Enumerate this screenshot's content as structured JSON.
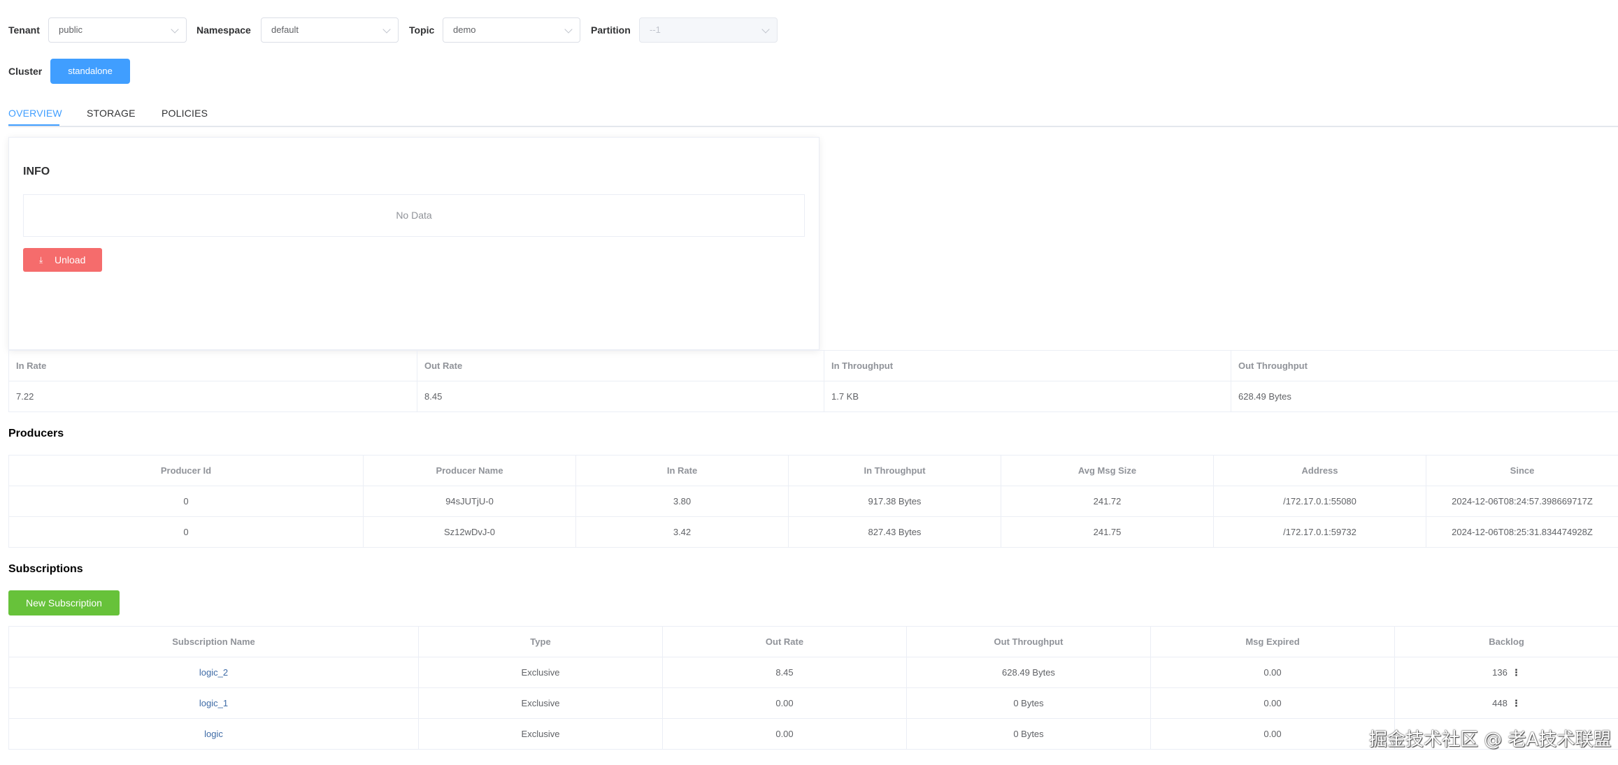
{
  "filters": {
    "tenant": {
      "label": "Tenant",
      "value": "public"
    },
    "namespace": {
      "label": "Namespace",
      "value": "default"
    },
    "topic": {
      "label": "Topic",
      "value": "demo"
    },
    "partition": {
      "label": "Partition",
      "value": "--1"
    }
  },
  "cluster": {
    "label": "Cluster",
    "button": "standalone"
  },
  "tabs": [
    {
      "label": "OVERVIEW",
      "active": true
    },
    {
      "label": "STORAGE",
      "active": false
    },
    {
      "label": "POLICIES",
      "active": false
    }
  ],
  "info": {
    "title": "INFO",
    "empty_text": "No Data",
    "unload_label": "Unload",
    "unload_icon": "download-icon"
  },
  "stats": {
    "headers": [
      "In Rate",
      "Out Rate",
      "In Throughput",
      "Out Throughput"
    ],
    "values": [
      "7.22",
      "8.45",
      "1.7 KB",
      "628.49 Bytes"
    ]
  },
  "producers": {
    "title": "Producers",
    "headers": [
      "Producer Id",
      "Producer Name",
      "In Rate",
      "In Throughput",
      "Avg Msg Size",
      "Address",
      "Since"
    ],
    "rows": [
      [
        "0",
        "94sJUTjU-0",
        "3.80",
        "917.38 Bytes",
        "241.72",
        "/172.17.0.1:55080",
        "2024-12-06T08:24:57.398669717Z"
      ],
      [
        "0",
        "Sz12wDvJ-0",
        "3.42",
        "827.43 Bytes",
        "241.75",
        "/172.17.0.1:59732",
        "2024-12-06T08:25:31.834474928Z"
      ]
    ]
  },
  "subscriptions": {
    "title": "Subscriptions",
    "new_button": "New Subscription",
    "headers": [
      "Subscription Name",
      "Type",
      "Out Rate",
      "Out Throughput",
      "Msg Expired",
      "Backlog"
    ],
    "rows": [
      [
        "logic_2",
        "Exclusive",
        "8.45",
        "628.49 Bytes",
        "0.00",
        "136"
      ],
      [
        "logic_1",
        "Exclusive",
        "0.00",
        "0 Bytes",
        "0.00",
        "448"
      ],
      [
        "logic",
        "Exclusive",
        "0.00",
        "0 Bytes",
        "0.00",
        ""
      ]
    ]
  },
  "watermark": "掘金技术社区 @ 老A技术联盟",
  "colors": {
    "primary": "#409eff",
    "danger": "#f56c6c",
    "success": "#67c23a",
    "link": "#3e6ba6"
  }
}
